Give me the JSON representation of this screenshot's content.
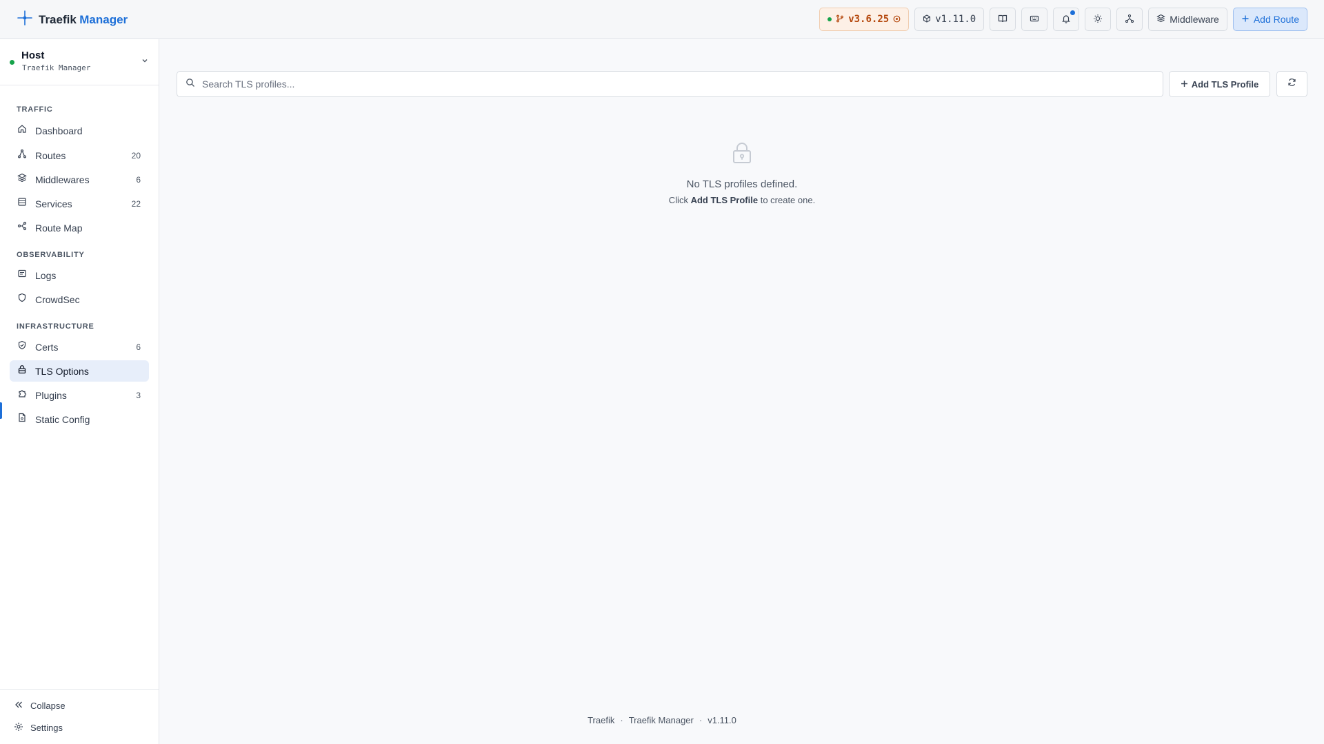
{
  "app": {
    "brand_primary": "Traefik",
    "brand_accent": "Manager",
    "accent_color": "#1d6fd8"
  },
  "header": {
    "traefik_version": "v3.6.25",
    "app_version": "v1.11.0",
    "middleware_label": "Middleware",
    "add_route_label": "Add Route",
    "icons": [
      "book-icon",
      "keyboard-icon",
      "bell-icon",
      "sun-icon",
      "network-icon"
    ]
  },
  "sidebar": {
    "host": {
      "title": "Host",
      "subtitle": "Traefik Manager",
      "status_color": "#16a34a"
    },
    "sections": [
      {
        "label": "TRAFFIC",
        "items": [
          {
            "label": "Dashboard",
            "count": "",
            "icon": "home-icon"
          },
          {
            "label": "Routes",
            "count": "20",
            "icon": "routes-icon"
          },
          {
            "label": "Middlewares",
            "count": "6",
            "icon": "layers-icon"
          },
          {
            "label": "Services",
            "count": "22",
            "icon": "server-icon"
          },
          {
            "label": "Route Map",
            "count": "",
            "icon": "map-icon"
          }
        ]
      },
      {
        "label": "OBSERVABILITY",
        "items": [
          {
            "label": "Logs",
            "count": "",
            "icon": "logs-icon"
          },
          {
            "label": "CrowdSec",
            "count": "",
            "icon": "shield-icon"
          }
        ]
      },
      {
        "label": "INFRASTRUCTURE",
        "items": [
          {
            "label": "Certs",
            "count": "6",
            "icon": "shield-check-icon"
          },
          {
            "label": "TLS Options",
            "count": "",
            "icon": "lock-icon",
            "active": true
          },
          {
            "label": "Plugins",
            "count": "3",
            "icon": "puzzle-icon"
          },
          {
            "label": "Static Config",
            "count": "",
            "icon": "file-icon"
          }
        ]
      }
    ],
    "collapse_label": "Collapse",
    "settings_label": "Settings"
  },
  "main": {
    "search_placeholder": "Search TLS profiles...",
    "add_button_label": "Add TLS Profile",
    "empty_title": "No TLS profiles defined.",
    "empty_prefix": "Click",
    "empty_bold": "Add TLS Profile",
    "empty_suffix": "to create one."
  },
  "footer": {
    "part1": "Traefik",
    "part2": "Traefik Manager",
    "part3": "v1.11.0",
    "separator": "·"
  }
}
